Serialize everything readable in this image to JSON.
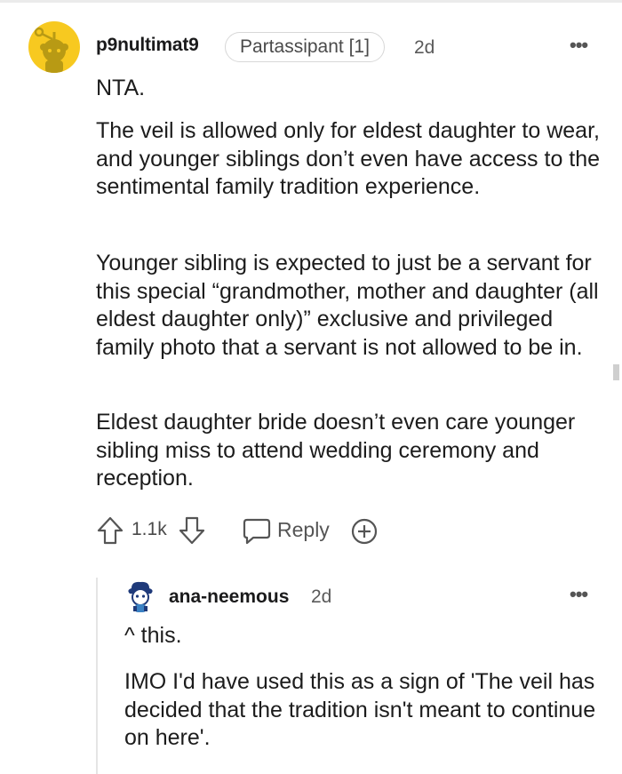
{
  "comment": {
    "username": "p9nultimat9",
    "flair": "Partassipant [1]",
    "time": "2d",
    "paragraphs": [
      "NTA.",
      "The veil is allowed only for eldest daughter to wear, and younger siblings don’t even have access to the sentimental family tradition experience.",
      "Younger sibling is expected to just be a servant for this special “grandmother, mother and daughter (all eldest daughter only)” exclusive and privileged family photo that a servant is not allowed to be in.",
      "Eldest daughter bride doesn’t even care younger sibling miss to attend wedding ceremony and reception."
    ],
    "votes": "1.1k",
    "reply_label": "Reply",
    "more_label": "•••"
  },
  "reply": {
    "username": "ana-neemous",
    "time": "2d",
    "more_label": "•••",
    "paragraphs": [
      "^ this.",
      "IMO I'd have used this as a sign of 'The veil has decided that the tradition isn't meant to continue on here'."
    ]
  },
  "colors": {
    "avatar_yellow": "#f7c920",
    "text": "#1c1c1c",
    "muted": "#5a5a5a",
    "thread_line": "#e5e5e5"
  },
  "icons": {
    "avatar": "snoo-avatar-icon",
    "upvote": "upvote-arrow-icon",
    "downvote": "downvote-arrow-icon",
    "reply": "speech-bubble-icon",
    "award": "award-plus-icon",
    "more": "more-options-icon"
  }
}
